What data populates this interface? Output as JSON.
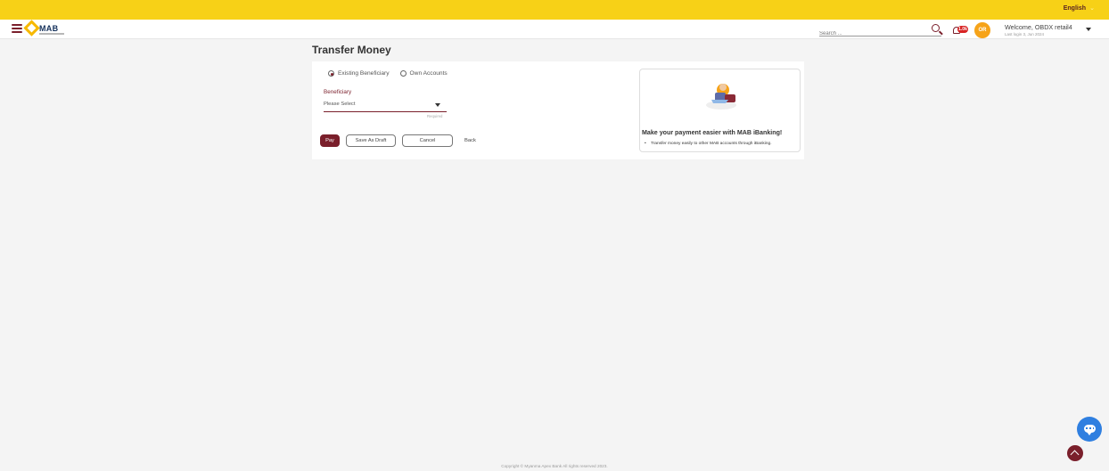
{
  "topbar": {
    "language": "English"
  },
  "header": {
    "logo_text": "MAB",
    "search_placeholder": "Search ...",
    "notification_count": "1.0k",
    "avatar_initials": "OR",
    "welcome": "Welcome, OBDX retail4",
    "last_login": "Last login 3, Jun 2024"
  },
  "page": {
    "title": "Transfer Money"
  },
  "form": {
    "radio_existing": "Existing Beneficiary",
    "radio_own": "Own Accounts",
    "beneficiary_label": "Beneficiary",
    "beneficiary_value": "Please Select",
    "required": "Required",
    "pay": "Pay",
    "save_draft": "Save As Draft",
    "cancel": "Cancel",
    "back": "Back"
  },
  "promo": {
    "title": "Make your payment easier with MAB iBanking!",
    "bullet": "Transfer money easily to other MAB accounts through iBanking."
  },
  "footer": {
    "copyright": "Copyright © Myanma Apex Bank All rights reserved 2023."
  },
  "colors": {
    "brand": "#7a1f2b",
    "topbar": "#f7d117",
    "chat": "#2f7fe0",
    "avatar": "#f6a319"
  }
}
